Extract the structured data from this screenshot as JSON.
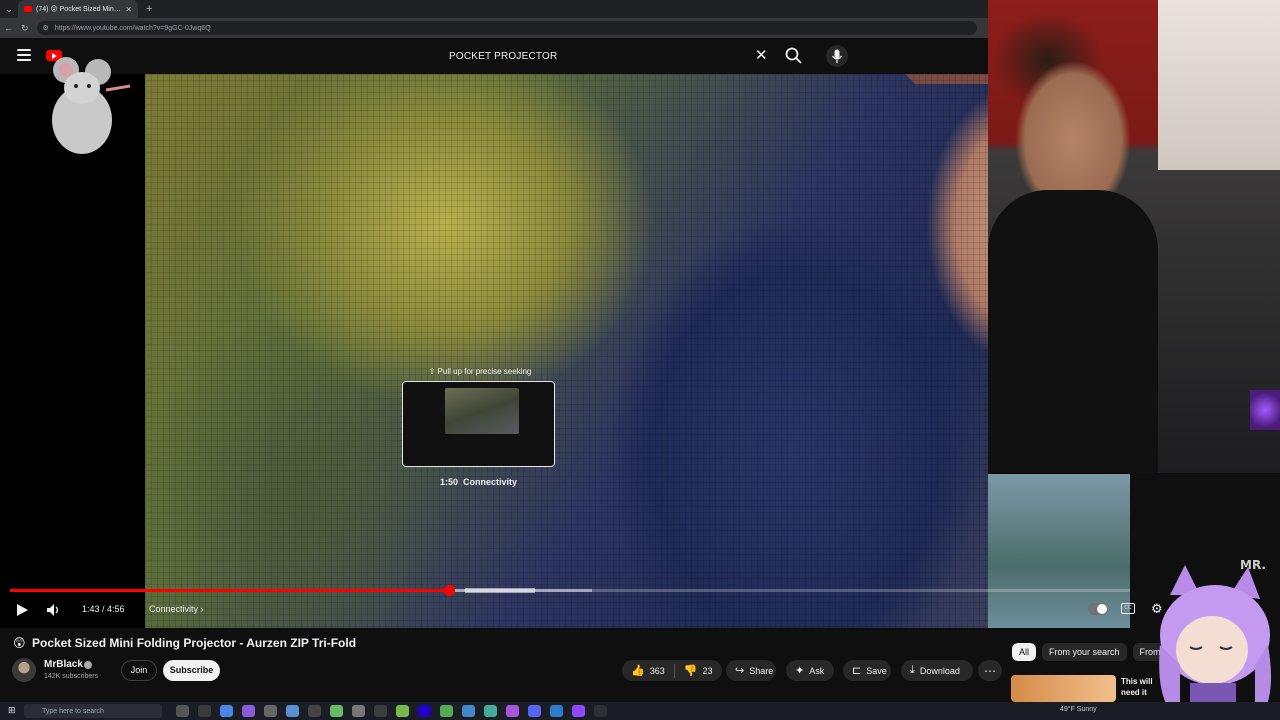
{
  "browser": {
    "tab_title": "(74) 😲 Pocket Sized Mini Folding",
    "url": "https://www.youtube.com/watch?v=9gGC-0Jwq6Q"
  },
  "header": {
    "search_query": "POCKET PROJECTOR"
  },
  "player": {
    "seek_hint": "⇧ Pull up for precise seeking",
    "preview_time": "1:50",
    "preview_chapter": "Connectivity",
    "current_time": "1:43 / 4:56",
    "chapter": "Connectivity",
    "played_fraction": 0.392,
    "buffered_fraction": 0.52,
    "watermark": "MR."
  },
  "video": {
    "title_emoji": "😲",
    "title": "Pocket Sized Mini Folding Projector - Aurzen ZIP Tri-Fold",
    "channel": "MrBlack",
    "subscribers": "142K subscribers",
    "join_label": "Join",
    "subscribe_label": "Subscribe",
    "likes": "363",
    "dislikes": "23",
    "share_label": "Share",
    "ask_label": "Ask",
    "save_label": "Save",
    "download_label": "Download"
  },
  "chips": [
    "All",
    "From your search",
    "From"
  ],
  "recommendation": {
    "text_line1": "This will",
    "text_line2": "need it"
  },
  "taskbar": {
    "search_placeholder": "Type here to search",
    "weather": "49°F  Sunny"
  },
  "colors": {
    "accent": "#ff0000",
    "background": "#0f0f0f",
    "pill": "#272727"
  }
}
